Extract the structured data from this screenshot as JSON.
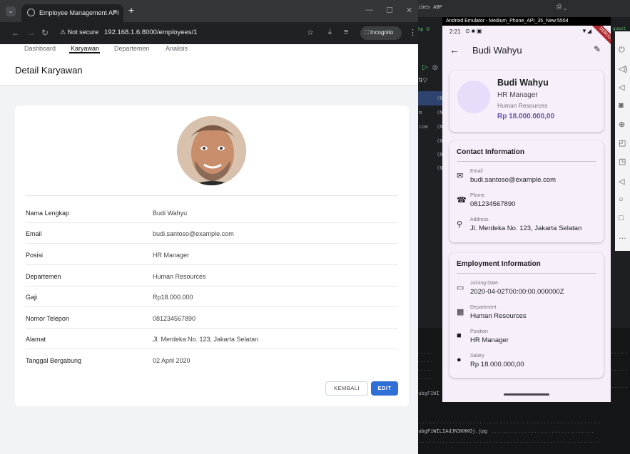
{
  "browser": {
    "tab_title": "Employee Management API",
    "tab_close": "×",
    "new_tab": "+",
    "not_secure": "Not secure",
    "url": "192.168.1.6:8000/employees/1",
    "incognito": "Incognito"
  },
  "nav": {
    "items": [
      "Dashboard",
      "Karyawan",
      "Departemen",
      "Analisis"
    ],
    "active": "Karyawan"
  },
  "page": {
    "title": "Detail Karyawan"
  },
  "details": [
    {
      "label": "Nama Lengkap",
      "value": "Budi Wahyu"
    },
    {
      "label": "Email",
      "value": "budi.santoso@example.com"
    },
    {
      "label": "Posisi",
      "value": "HR Manager"
    },
    {
      "label": "Departemen",
      "value": "Human Resources"
    },
    {
      "label": "Gaji",
      "value": "Rp18.000.000"
    },
    {
      "label": "Nomor Telepon",
      "value": "081234567890"
    },
    {
      "label": "Alamat",
      "value": "Jl. Merdeka No. 123, Jakarta Selatan"
    },
    {
      "label": "Tanggal Bergabung",
      "value": "02 April 2020"
    }
  ],
  "actions": {
    "back": "KEMBALI",
    "edit": "EDIT"
  },
  "emulator": {
    "window_title": "Android Emulator - Medium_Phone_API_35_New:5554",
    "time": "2:21",
    "debug_banner": "DEBUG",
    "appbar_title": "Budi Wahyu",
    "profile": {
      "name": "Budi Wahyu",
      "position": "HR Manager",
      "department": "Human Resources",
      "salary": "Rp 18.000.000,00"
    },
    "contact": {
      "title": "Contact Information",
      "items": [
        {
          "label": "Email",
          "value": "budi.santoso@example.com",
          "icon": "email-icon"
        },
        {
          "label": "Phone",
          "value": "081234567890",
          "icon": "phone-icon"
        },
        {
          "label": "Address",
          "value": "Jl. Merdeka No. 123, Jakarta Selatan",
          "icon": "location-pin-icon"
        }
      ]
    },
    "employment": {
      "title": "Employment Information",
      "items": [
        {
          "label": "Joining Date",
          "value": "2020-04-02T00:00:00.000000Z",
          "icon": "calendar-icon"
        },
        {
          "label": "Department",
          "value": "Human Resources",
          "icon": "building-icon"
        },
        {
          "label": "Position",
          "value": "HR Manager",
          "icon": "briefcase-icon"
        },
        {
          "label": "Salary",
          "value": "Rp 18.000.000,00",
          "icon": "money-icon"
        }
      ]
    }
  },
  "background": {
    "ide_tab": "ibes ABP",
    "ide_side_text": "hp U",
    "guest": "guest",
    "ide_rows": [
      "(N",
      "m",
      "(N",
      "com",
      "(N",
      "(N",
      "(N",
      "(N"
    ],
    "terminal_line1": "qubgF1WI",
    "terminal_line2": "qubgFiWILIAdJN3KHKOj.jpg"
  },
  "colors": {
    "primary_button": "#2f6fd6",
    "accent_purple": "#6750a4",
    "debug_banner": "#b0282f"
  }
}
